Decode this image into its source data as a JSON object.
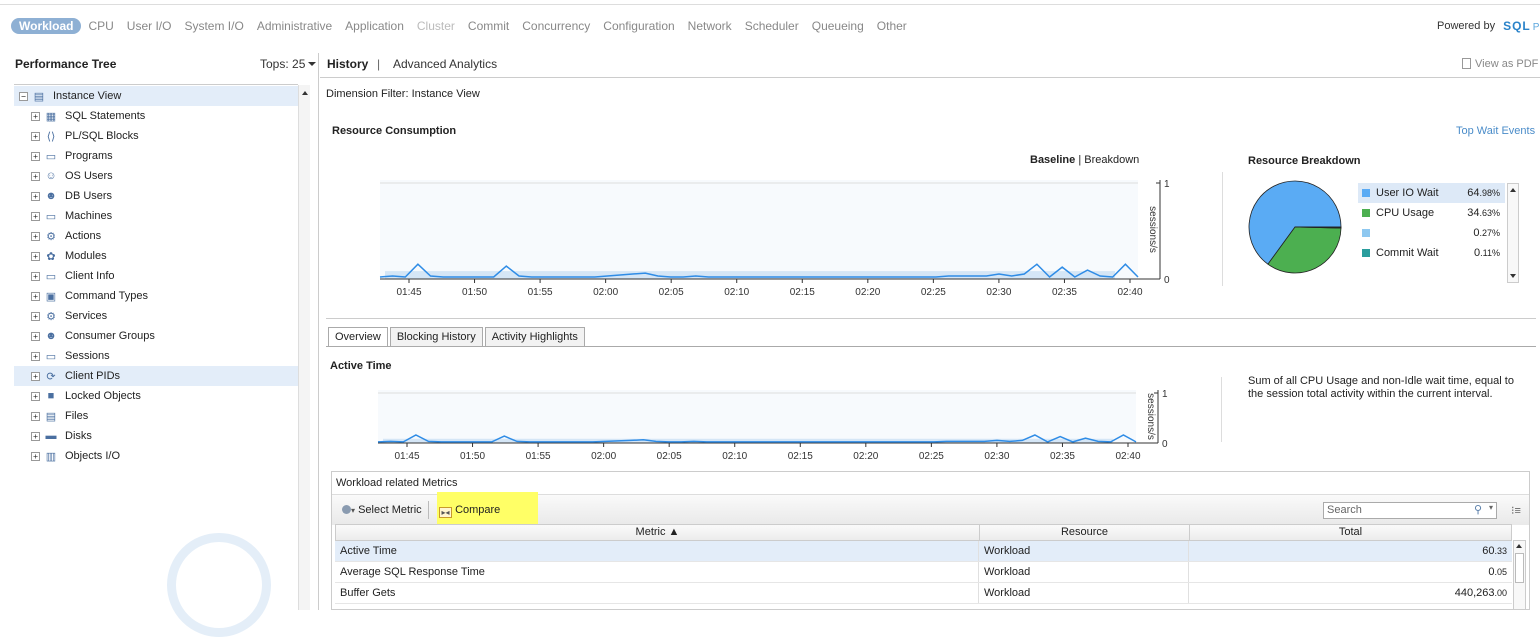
{
  "nav": {
    "items": [
      "Workload",
      "CPU",
      "User I/O",
      "System I/O",
      "Administrative",
      "Application",
      "Cluster",
      "Commit",
      "Concurrency",
      "Configuration",
      "Network",
      "Scheduler",
      "Queueing",
      "Other"
    ],
    "powered_label": "Powered by",
    "logo_text": "SQL",
    "logo_suffix": "PI"
  },
  "left_panel": {
    "title": "Performance Tree",
    "tops_label": "Tops: 25",
    "tree": [
      {
        "label": "Instance View",
        "icon": "instance-icon",
        "toggle": "−"
      },
      {
        "label": "SQL Statements",
        "icon": "sql-icon",
        "toggle": "+"
      },
      {
        "label": "PL/SQL Blocks",
        "icon": "plsql-icon",
        "toggle": "+"
      },
      {
        "label": "Programs",
        "icon": "programs-icon",
        "toggle": "+"
      },
      {
        "label": "OS Users",
        "icon": "os-users-icon",
        "toggle": "+"
      },
      {
        "label": "DB Users",
        "icon": "db-users-icon",
        "toggle": "+"
      },
      {
        "label": "Machines",
        "icon": "machine-icon",
        "toggle": "+"
      },
      {
        "label": "Actions",
        "icon": "actions-icon",
        "toggle": "+"
      },
      {
        "label": "Modules",
        "icon": "modules-icon",
        "toggle": "+"
      },
      {
        "label": "Client Info",
        "icon": "client-info-icon",
        "toggle": "+"
      },
      {
        "label": "Command Types",
        "icon": "command-icon",
        "toggle": "+"
      },
      {
        "label": "Services",
        "icon": "services-icon",
        "toggle": "+"
      },
      {
        "label": "Consumer Groups",
        "icon": "consumer-groups-icon",
        "toggle": "+"
      },
      {
        "label": "Sessions",
        "icon": "sessions-icon",
        "toggle": "+"
      },
      {
        "label": "Client PIDs",
        "icon": "client-pids-icon",
        "toggle": "+"
      },
      {
        "label": "Locked Objects",
        "icon": "lock-icon",
        "toggle": "+"
      },
      {
        "label": "Files",
        "icon": "files-icon",
        "toggle": "+"
      },
      {
        "label": "Disks",
        "icon": "disk-icon",
        "toggle": "+"
      },
      {
        "label": "Objects I/O",
        "icon": "objects-io-icon",
        "toggle": "+"
      }
    ],
    "selected_index": 0,
    "hover_index": 14
  },
  "header": {
    "history": "History",
    "separator": "|",
    "advanced": "Advanced Analytics",
    "view_pdf": "View as PDF"
  },
  "dimension_filter": "Dimension Filter: Instance View",
  "resource": {
    "title": "Resource Consumption",
    "top_wait": "Top Wait Events",
    "baseline": "Baseline",
    "sep": "|",
    "breakdown": "Breakdown"
  },
  "breakdown": {
    "title": "Resource Breakdown",
    "items": [
      {
        "label": "User IO Wait",
        "pct_main": "64",
        "pct_dec": ".98%",
        "color": "#5aabf4"
      },
      {
        "label": "CPU Usage",
        "pct_main": "34",
        "pct_dec": ".63%",
        "color": "#4caf50"
      },
      {
        "label": "",
        "pct_main": "0",
        "pct_dec": ".27%",
        "color": "#8ec8f0"
      },
      {
        "label": "Commit Wait",
        "pct_main": "0",
        "pct_dec": ".11%",
        "color": "#2a9d9d"
      }
    ]
  },
  "tabs": [
    "Overview",
    "Blocking History",
    "Activity Highlights"
  ],
  "active_time": {
    "title": "Active Time",
    "description": "Sum of all CPU Usage and non-Idle wait time, equal to the session total activity within the current interval."
  },
  "chart_data": [
    {
      "type": "line",
      "ylabel": "sessions/s",
      "ylim": [
        0,
        1
      ],
      "yticks": [
        "1",
        "0"
      ],
      "categories": [
        "01:45",
        "01:50",
        "01:55",
        "02:00",
        "02:05",
        "02:10",
        "02:15",
        "02:20",
        "02:25",
        "02:30",
        "02:35",
        "02:40"
      ],
      "x": [
        0,
        1,
        2,
        3,
        4,
        5,
        6,
        7,
        8,
        9,
        10,
        11,
        12,
        13,
        14,
        15,
        16,
        17,
        18,
        19,
        20,
        21,
        22,
        23,
        24,
        25,
        26,
        27,
        28,
        29,
        30,
        31,
        32,
        33,
        34,
        35,
        36,
        37,
        38,
        39,
        40,
        41,
        42,
        43,
        44,
        45,
        46,
        47,
        48,
        49,
        50,
        51,
        52,
        53,
        54,
        55,
        56,
        57,
        58,
        59,
        60
      ],
      "series": [
        {
          "values": [
            0.02,
            0.03,
            0.02,
            0.15,
            0.03,
            0.02,
            0.02,
            0.02,
            0.02,
            0.02,
            0.13,
            0.03,
            0.02,
            0.02,
            0.02,
            0.02,
            0.02,
            0.02,
            0.03,
            0.04,
            0.05,
            0.06,
            0.03,
            0.02,
            0.02,
            0.03,
            0.02,
            0.02,
            0.02,
            0.02,
            0.02,
            0.02,
            0.02,
            0.02,
            0.02,
            0.02,
            0.02,
            0.02,
            0.02,
            0.02,
            0.02,
            0.02,
            0.02,
            0.02,
            0.02,
            0.03,
            0.03,
            0.03,
            0.03,
            0.05,
            0.03,
            0.05,
            0.15,
            0.02,
            0.12,
            0.02,
            0.09,
            0.03,
            0.02,
            0.15,
            0.02
          ]
        }
      ],
      "baseline": 0.08
    },
    {
      "type": "line",
      "ylabel": "sessions/s",
      "ylim": [
        0,
        1
      ],
      "yticks": [
        "1",
        "0"
      ],
      "categories": [
        "01:45",
        "01:50",
        "01:55",
        "02:00",
        "02:05",
        "02:10",
        "02:15",
        "02:20",
        "02:25",
        "02:30",
        "02:35",
        "02:40"
      ],
      "x": [
        0,
        1,
        2,
        3,
        4,
        5,
        6,
        7,
        8,
        9,
        10,
        11,
        12,
        13,
        14,
        15,
        16,
        17,
        18,
        19,
        20,
        21,
        22,
        23,
        24,
        25,
        26,
        27,
        28,
        29,
        30,
        31,
        32,
        33,
        34,
        35,
        36,
        37,
        38,
        39,
        40,
        41,
        42,
        43,
        44,
        45,
        46,
        47,
        48,
        49,
        50,
        51,
        52,
        53,
        54,
        55,
        56,
        57,
        58,
        59,
        60
      ],
      "series": [
        {
          "values": [
            0.02,
            0.03,
            0.02,
            0.15,
            0.03,
            0.02,
            0.02,
            0.02,
            0.02,
            0.02,
            0.13,
            0.03,
            0.02,
            0.02,
            0.02,
            0.02,
            0.02,
            0.02,
            0.03,
            0.04,
            0.05,
            0.06,
            0.03,
            0.02,
            0.02,
            0.03,
            0.02,
            0.02,
            0.02,
            0.02,
            0.02,
            0.02,
            0.02,
            0.02,
            0.02,
            0.02,
            0.02,
            0.02,
            0.02,
            0.02,
            0.02,
            0.02,
            0.02,
            0.02,
            0.02,
            0.03,
            0.03,
            0.03,
            0.03,
            0.05,
            0.03,
            0.05,
            0.15,
            0.02,
            0.12,
            0.02,
            0.09,
            0.03,
            0.02,
            0.15,
            0.02
          ]
        }
      ],
      "baseline": 0.08
    },
    {
      "type": "pie",
      "labels": [
        "User IO Wait",
        "CPU Usage",
        "",
        "Commit Wait"
      ],
      "values": [
        64.98,
        34.63,
        0.27,
        0.11
      ],
      "colors": [
        "#5aabf4",
        "#4caf50",
        "#8ec8f0",
        "#2a9d9d"
      ]
    }
  ],
  "metrics": {
    "title": "Workload related Metrics",
    "select_metric": "Select Metric",
    "compare": "Compare",
    "search_placeholder": "Search",
    "columns": [
      "Metric ▲",
      "Resource",
      "Total"
    ],
    "rows": [
      {
        "metric": "Active Time",
        "resource": "Workload",
        "total_main": "60",
        "total_dec": ".33"
      },
      {
        "metric": "Average SQL Response Time",
        "resource": "Workload",
        "total_main": "0",
        "total_dec": ".05"
      },
      {
        "metric": "Buffer Gets",
        "resource": "Workload",
        "total_main": "440,263",
        "total_dec": ".00"
      }
    ]
  }
}
